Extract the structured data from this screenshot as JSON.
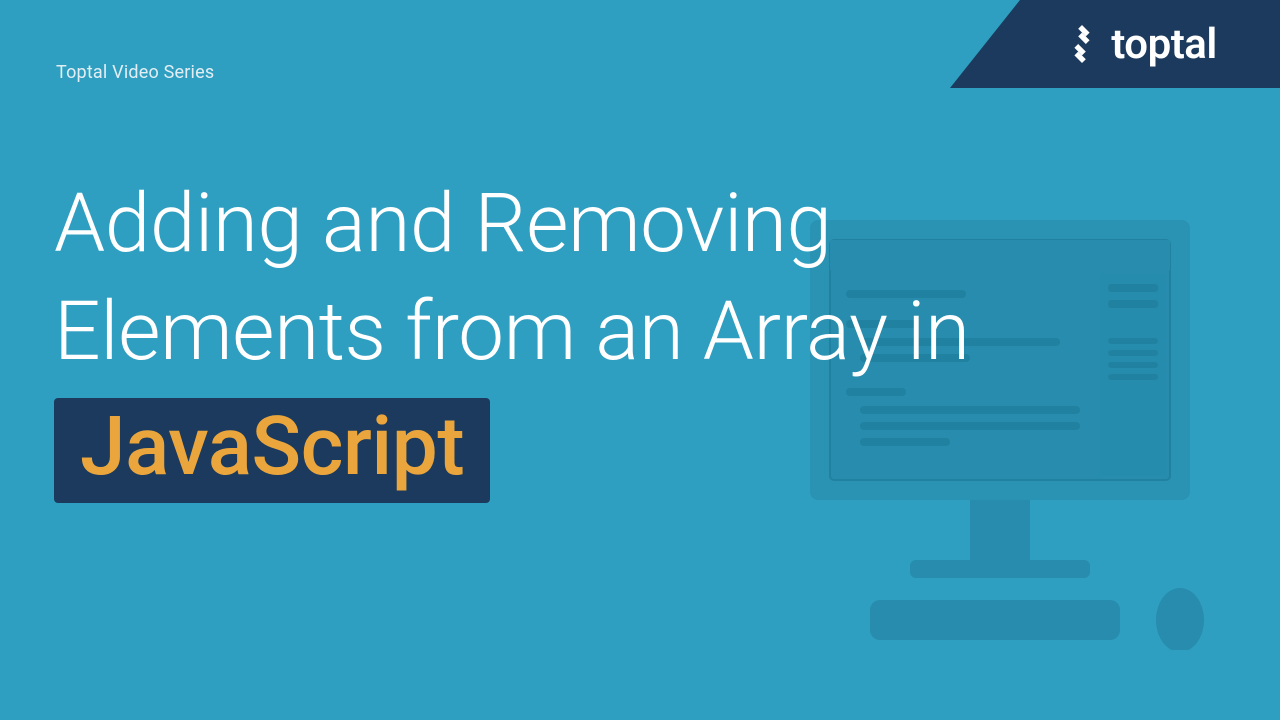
{
  "brand": {
    "name": "toptal",
    "logo_alt": "toptal-logo"
  },
  "subtitle": "Toptal Video Series",
  "headline": {
    "line1": "Adding and Removing",
    "line2": "Elements from an Array in",
    "tag": "JavaScript"
  },
  "colors": {
    "background": "#2f9fc1",
    "banner": "#1b3a5d",
    "tag_text": "#eaa63d"
  }
}
